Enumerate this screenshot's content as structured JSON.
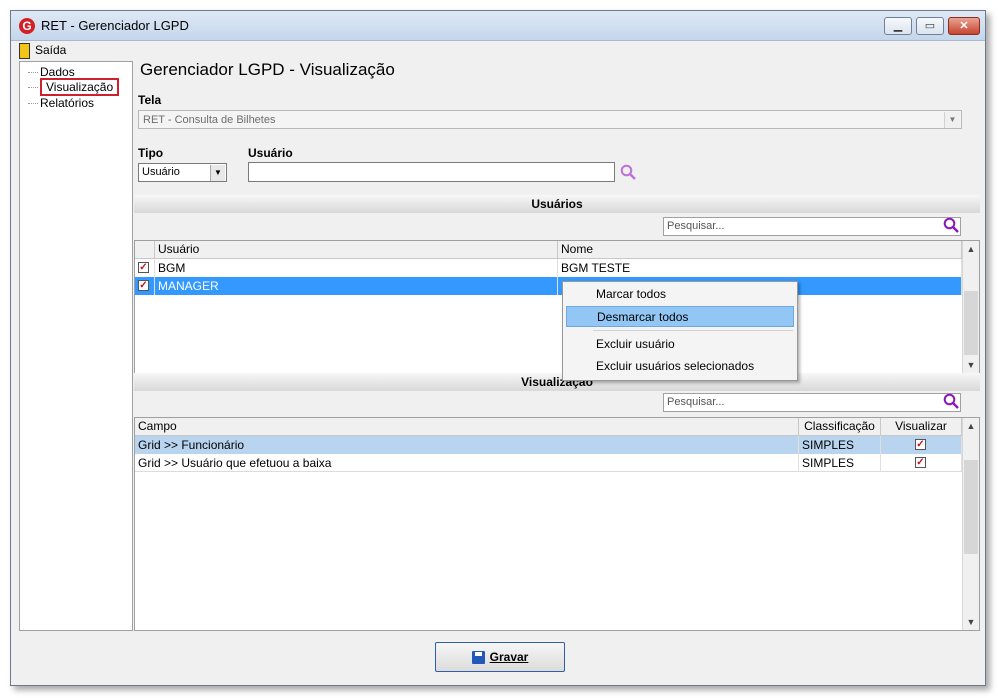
{
  "window": {
    "title": "RET - Gerenciador LGPD",
    "app_icon": "G"
  },
  "menubar": {
    "exit_label": "Saída"
  },
  "tree": {
    "items": [
      {
        "label": "Dados"
      },
      {
        "label": "Visualização"
      },
      {
        "label": "Relatórios"
      }
    ]
  },
  "main": {
    "heading": "Gerenciador LGPD - Visualização",
    "tela_label": "Tela",
    "tela_value": "RET - Consulta de Bilhetes",
    "tipo_label": "Tipo",
    "tipo_value": "Usuário",
    "usuario_label": "Usuário",
    "usuario_value": ""
  },
  "users_section": {
    "title": "Usuários",
    "search_placeholder": "Pesquisar...",
    "columns": [
      "Usuário",
      "Nome"
    ],
    "rows": [
      {
        "checked": true,
        "user": "BGM",
        "name": "BGM TESTE"
      },
      {
        "checked": true,
        "user": "MANAGER",
        "name": ""
      }
    ]
  },
  "context_menu": {
    "items": [
      "Marcar todos",
      "Desmarcar todos",
      "Excluir usuário",
      "Excluir usuários selecionados"
    ]
  },
  "vis_section": {
    "title": "Visualização",
    "search_placeholder": "Pesquisar...",
    "columns": [
      "Campo",
      "Classificação",
      "Visualizar"
    ],
    "rows": [
      {
        "campo": "Grid >> Funcionário",
        "classificacao": "SIMPLES",
        "visualizar": true
      },
      {
        "campo": "Grid >> Usuário que efetuou a baixa",
        "classificacao": "SIMPLES",
        "visualizar": true
      }
    ]
  },
  "footer": {
    "save_label": "Gravar"
  },
  "colors": {
    "selection": "#3399ff",
    "row_highlight": "#b8d4ee",
    "accent_red": "#d02030"
  }
}
